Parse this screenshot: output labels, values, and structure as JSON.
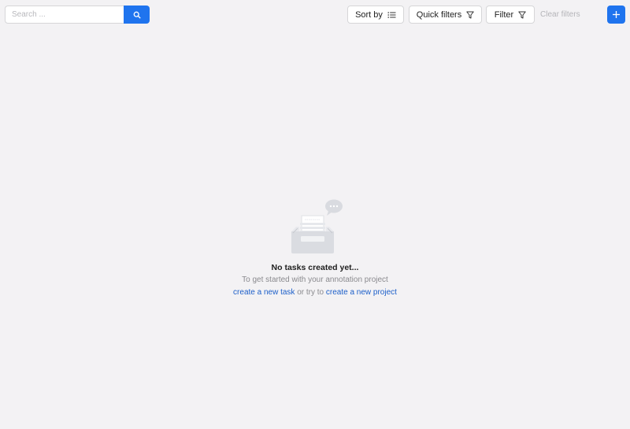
{
  "search": {
    "placeholder": "Search ...",
    "value": "",
    "button_icon": "search-icon"
  },
  "toolbar": {
    "sort_label": "Sort by",
    "sort_icon": "sort-list-icon",
    "quick_filters_label": "Quick filters",
    "quick_filters_icon": "filter-icon",
    "filter_label": "Filter",
    "filter_icon": "filter-icon",
    "clear_filters_label": "Clear filters",
    "add_icon": "plus-icon"
  },
  "empty_state": {
    "illustration": "empty-inbox-tray-with-chat-bubble",
    "title": "No tasks created yet...",
    "subtitle": "To get started with your annotation project",
    "link_create_task": "create a new task",
    "connector": " or try to ",
    "link_create_project": "create a new project"
  },
  "colors": {
    "background": "#f3f2f4",
    "accent": "#1f74ee",
    "link": "#1c5fc9",
    "muted_text": "#8a8a8e",
    "disabled_text": "#b4b4b8"
  }
}
